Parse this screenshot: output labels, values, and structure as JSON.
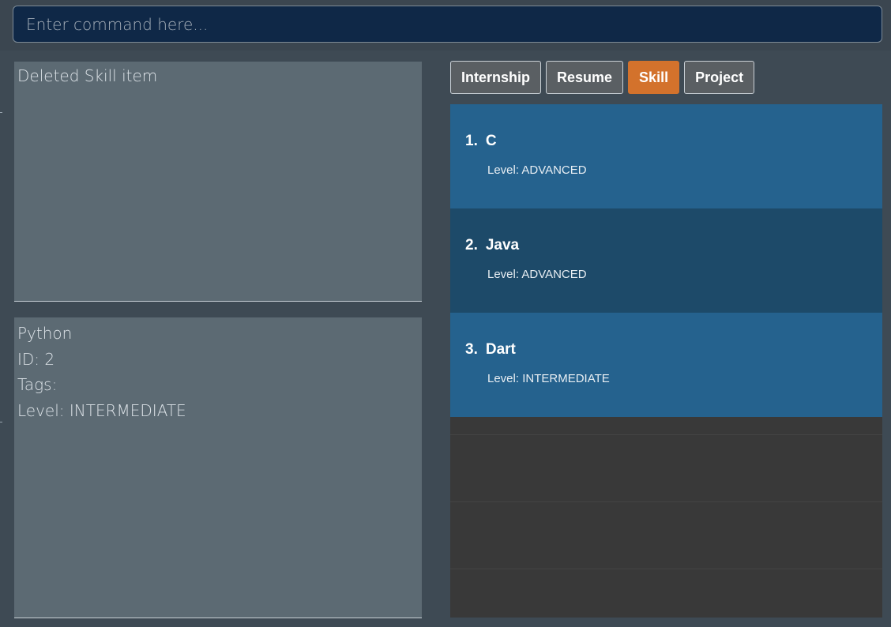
{
  "command": {
    "placeholder": "Enter command here...",
    "value": ""
  },
  "result": {
    "message": "Deleted Skill item"
  },
  "detail": {
    "lines": [
      "Python",
      "ID: 2",
      "Tags:",
      "Level: INTERMEDIATE"
    ]
  },
  "tabs": [
    {
      "label": "Internship",
      "active": false
    },
    {
      "label": "Resume",
      "active": false
    },
    {
      "label": "Skill",
      "active": true
    },
    {
      "label": "Project",
      "active": false
    }
  ],
  "skills": [
    {
      "index": "1.",
      "name": "C",
      "level": "Level: ADVANCED"
    },
    {
      "index": "2.",
      "name": "Java",
      "level": "Level: ADVANCED"
    },
    {
      "index": "3.",
      "name": "Dart",
      "level": "Level: INTERMEDIATE"
    }
  ],
  "colors": {
    "active_tab": "#d3722c",
    "card_light": "#25628e",
    "card_dark": "#1d4a69",
    "command_bg": "#0f2847"
  }
}
